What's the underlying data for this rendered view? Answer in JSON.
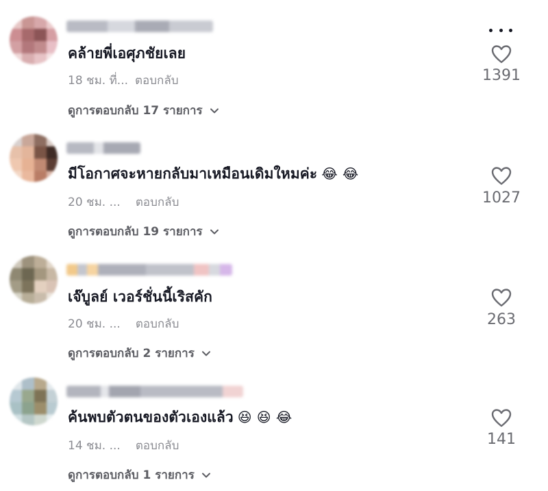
{
  "comments": [
    {
      "text": "คล้ายพี่เอศุภชัยเลย",
      "emoji": "",
      "time": "18 ชม. ที่...",
      "reply_label": "ตอบกลับ",
      "view_replies": "ดูการตอบกลับ 17 รายการ",
      "likes": "1391",
      "has_more_menu": true
    },
    {
      "text": "มีโอกาศจะหายกลับมาเหมือนเดิมใหมค่ะ",
      "emoji": "😂 😂",
      "time": "20 ชม. ...",
      "reply_label": "ตอบกลับ",
      "view_replies": "ดูการตอบกลับ 19 รายการ",
      "likes": "1027",
      "has_more_menu": false
    },
    {
      "text": "เจ๊บูลย์ เวอร์ชั่นนี้เริสคัก",
      "emoji": "",
      "time": "20 ชม. ...",
      "reply_label": "ตอบกลับ",
      "view_replies": "ดูการตอบกลับ 2 รายการ",
      "likes": "263",
      "has_more_menu": false
    },
    {
      "text": "ค้นพบตัวตนของตัวเองแล้ว",
      "emoji": "😆 😆 😂",
      "time": "14 ชม. ...",
      "reply_label": "ตอบกลับ",
      "view_replies": "ดูการตอบกลับ 1 รายการ",
      "likes": "141",
      "has_more_menu": false
    }
  ],
  "icons": {
    "like": "heart-outline-icon",
    "more": "more-dots-icon",
    "expand": "chevron-down-icon"
  },
  "colors": {
    "text_primary": "#161823",
    "text_secondary": "#8a8b91",
    "like_count": "#6a6b71"
  }
}
